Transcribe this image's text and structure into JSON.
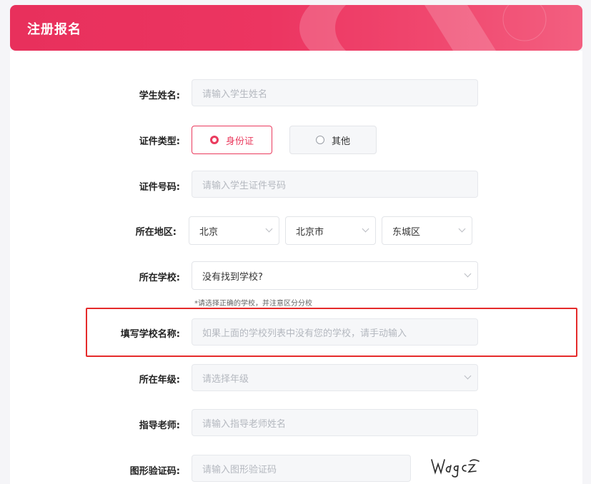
{
  "header": {
    "title": "注册报名"
  },
  "form": {
    "student_name": {
      "label": "学生姓名:",
      "placeholder": "请输入学生姓名"
    },
    "id_type": {
      "label": "证件类型:",
      "options": [
        "身份证",
        "其他"
      ],
      "selected": "身份证"
    },
    "id_number": {
      "label": "证件号码:",
      "placeholder": "请输入学生证件号码"
    },
    "region": {
      "label": "所在地区:",
      "province": "北京",
      "city": "北京市",
      "district": "东城区"
    },
    "school": {
      "label": "所在学校:",
      "value": "没有找到学校?",
      "hint": "*请选择正确的学校，并注意区分分校"
    },
    "school_name": {
      "label": "填写学校名称:",
      "placeholder": "如果上面的学校列表中没有您的学校，请手动输入"
    },
    "grade": {
      "label": "所在年级:",
      "placeholder": "请选择年级"
    },
    "teacher": {
      "label": "指导老师:",
      "placeholder": "请输入指导老师姓名"
    },
    "captcha": {
      "label": "图形验证码:",
      "placeholder": "请输入图形验证码",
      "image_text": "Wagcz"
    }
  },
  "colors": {
    "accent": "#ea3b5e",
    "highlight_border": "#e52b2b"
  }
}
